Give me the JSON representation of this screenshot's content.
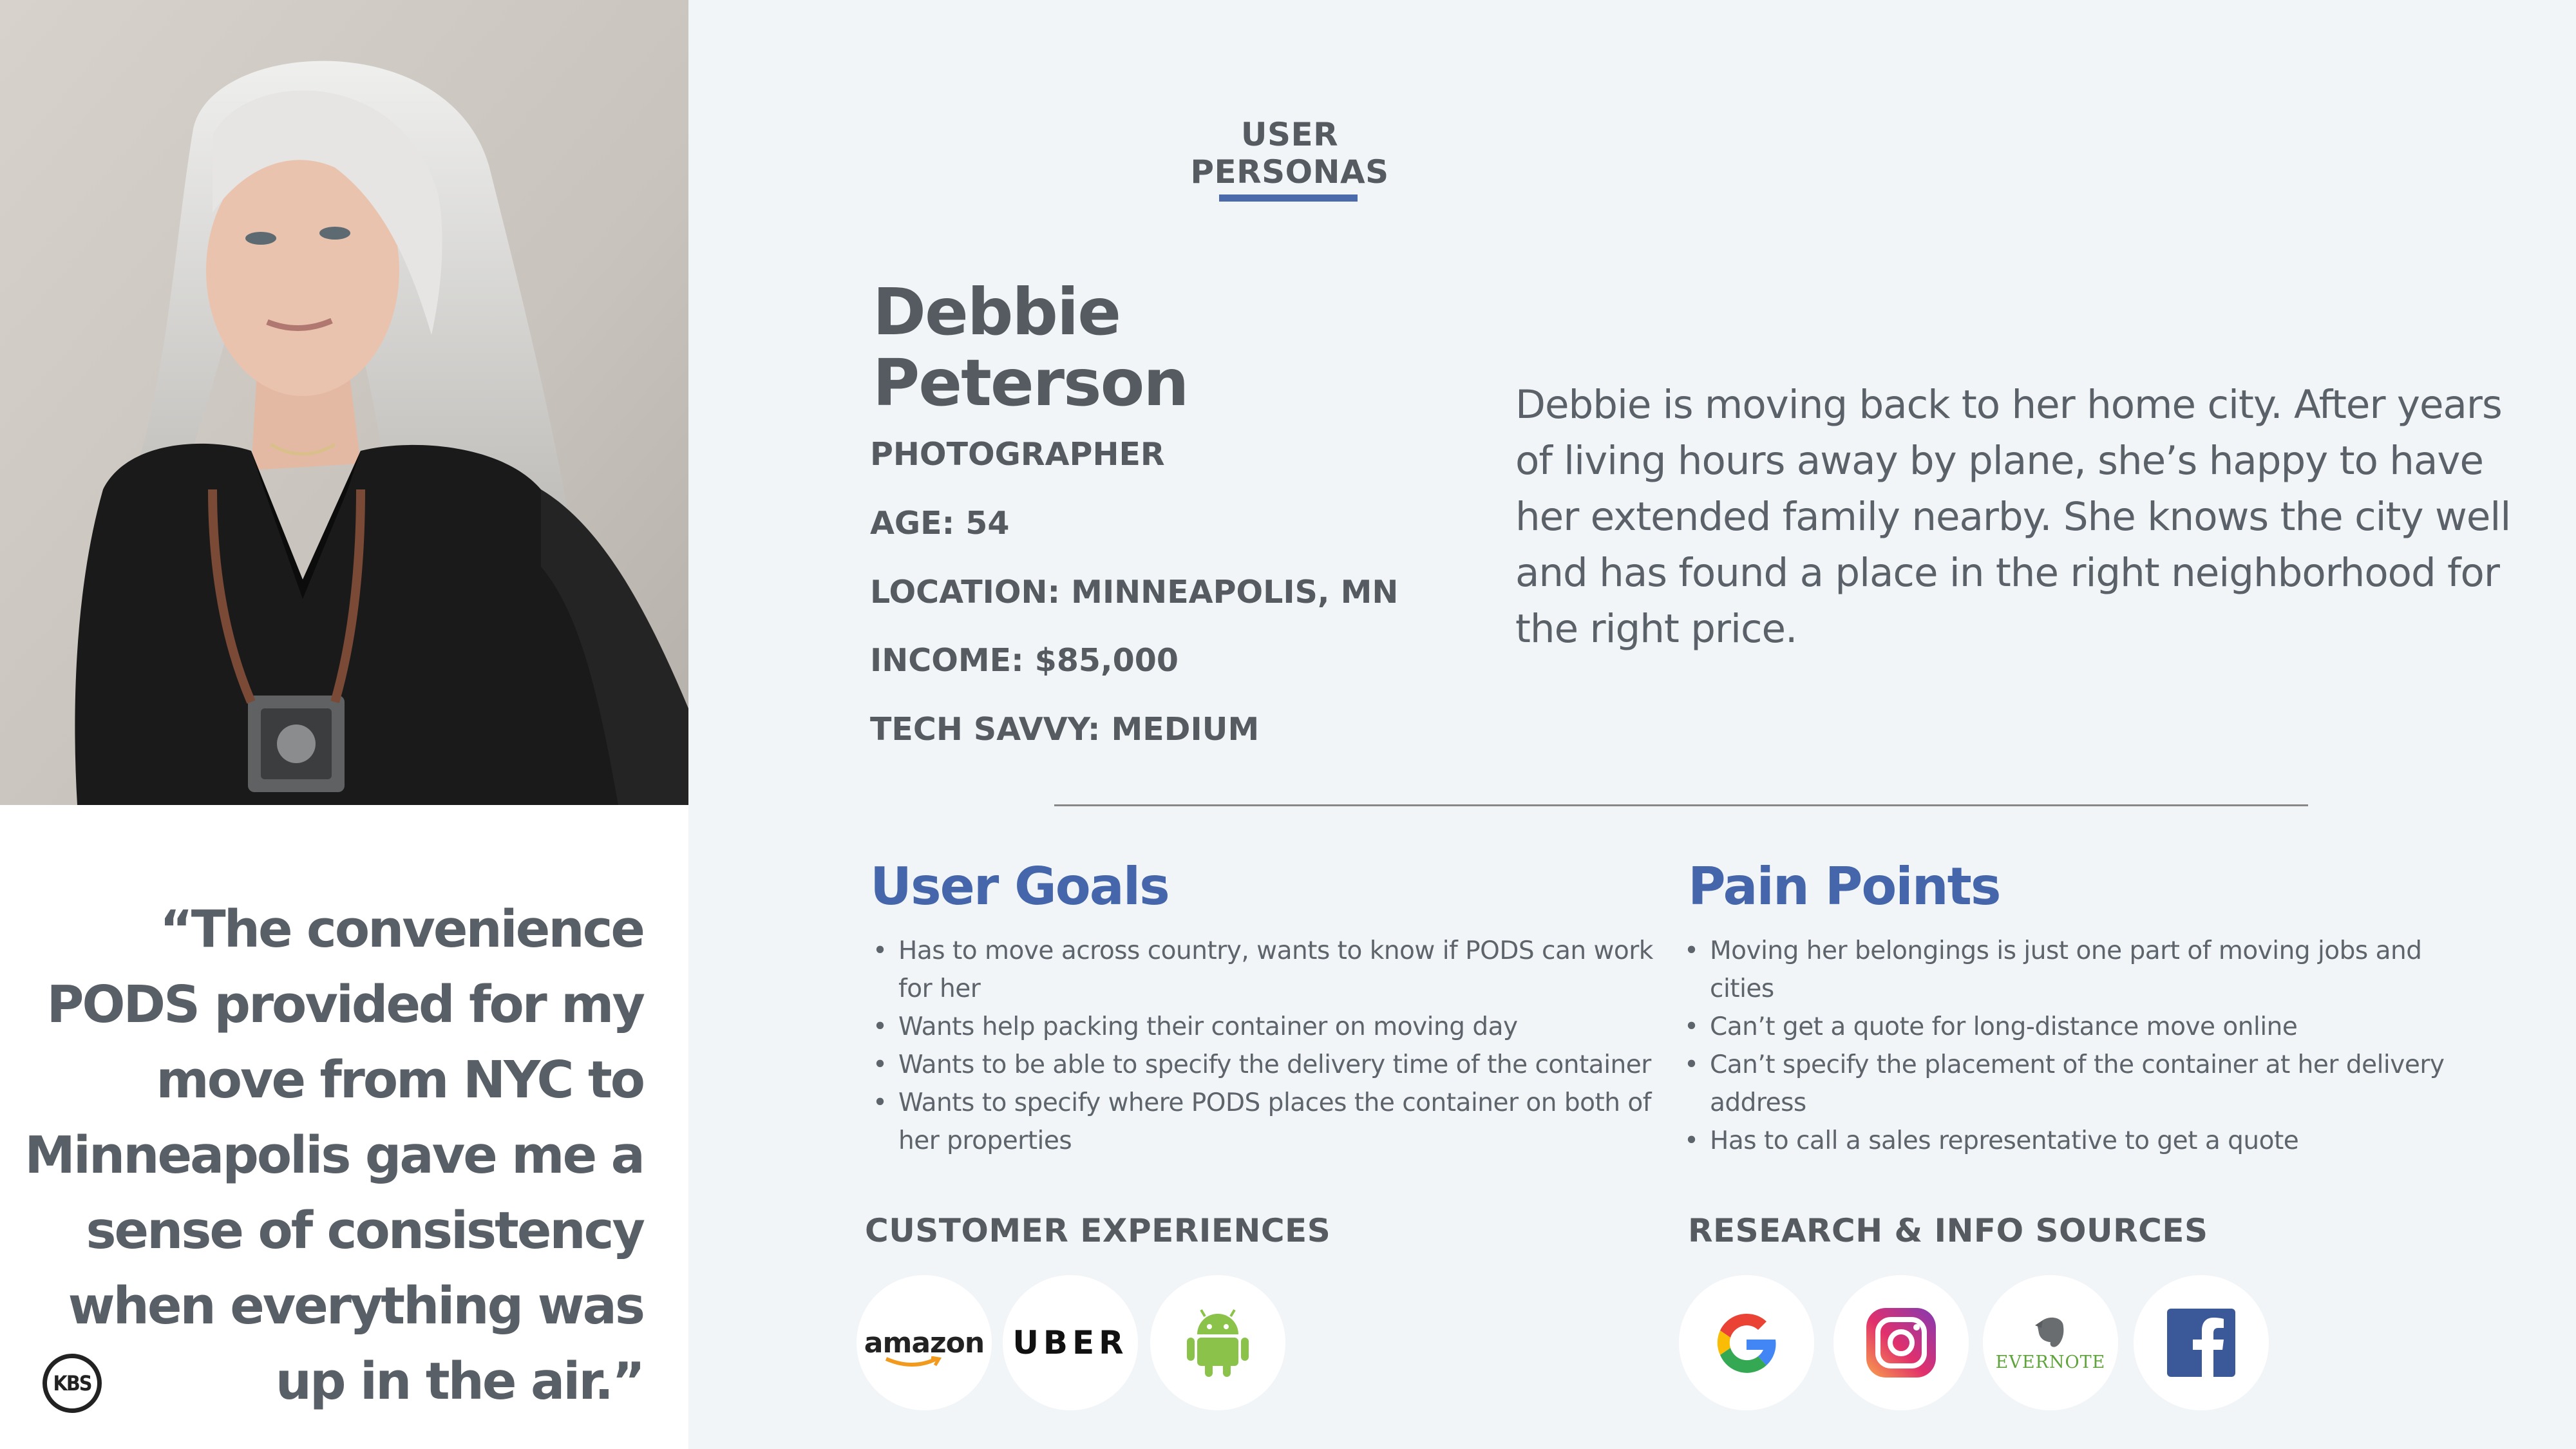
{
  "header": {
    "section_title": "USER PERSONAS"
  },
  "persona": {
    "first_name": "Debbie",
    "last_name": "Peterson",
    "occupation": "PHOTOGRAPHER",
    "age": "AGE: 54",
    "location": "LOCATION: MINNEAPOLIS, MN",
    "income": "INCOME: $85,000",
    "tech_savvy": "TECH SAVVY: MEDIUM",
    "bio": "Debbie is moving back to her home city. After years of living hours away by plane, she’s happy to have her extended family nearby. She knows the city well and has found a place in the right neighborhood for the right price."
  },
  "quote": "“The convenience PODS provided for my move from NYC to Minneapolis gave me a sense of consistency when everything was up in the air.”",
  "brand": {
    "logo_text": "KBS"
  },
  "goals": {
    "title": "User Goals",
    "items": [
      "Has to move across country, wants to know if PODS can work for her",
      "Wants help packing their container on moving day",
      "Wants to be able to specify the delivery time of the container",
      "Wants to specify where PODS places the container on both of her properties"
    ]
  },
  "pain_points": {
    "title": "Pain Points",
    "items": [
      "Moving her belongings is just one part of moving jobs and cities",
      "Can’t get a quote for long-distance move online",
      "Can’t specify the placement of the container at her delivery address",
      "Has to call a sales representative to get a quote"
    ]
  },
  "customer_experiences": {
    "title": "CUSTOMER EXPERIENCES",
    "logos": [
      {
        "name": "amazon",
        "label": "amazon"
      },
      {
        "name": "uber",
        "label": "UBER"
      },
      {
        "name": "android",
        "icon": "android-icon"
      }
    ]
  },
  "research_sources": {
    "title": "RESEARCH & INFO SOURCES",
    "logos": [
      {
        "name": "google",
        "icon": "google-icon"
      },
      {
        "name": "instagram",
        "icon": "instagram-icon"
      },
      {
        "name": "evernote",
        "label": "EVERNOTE"
      },
      {
        "name": "facebook",
        "icon": "facebook-icon"
      }
    ]
  },
  "colors": {
    "accent": "#4566ab",
    "text": "#555b61",
    "background": "#f2f5f7"
  }
}
